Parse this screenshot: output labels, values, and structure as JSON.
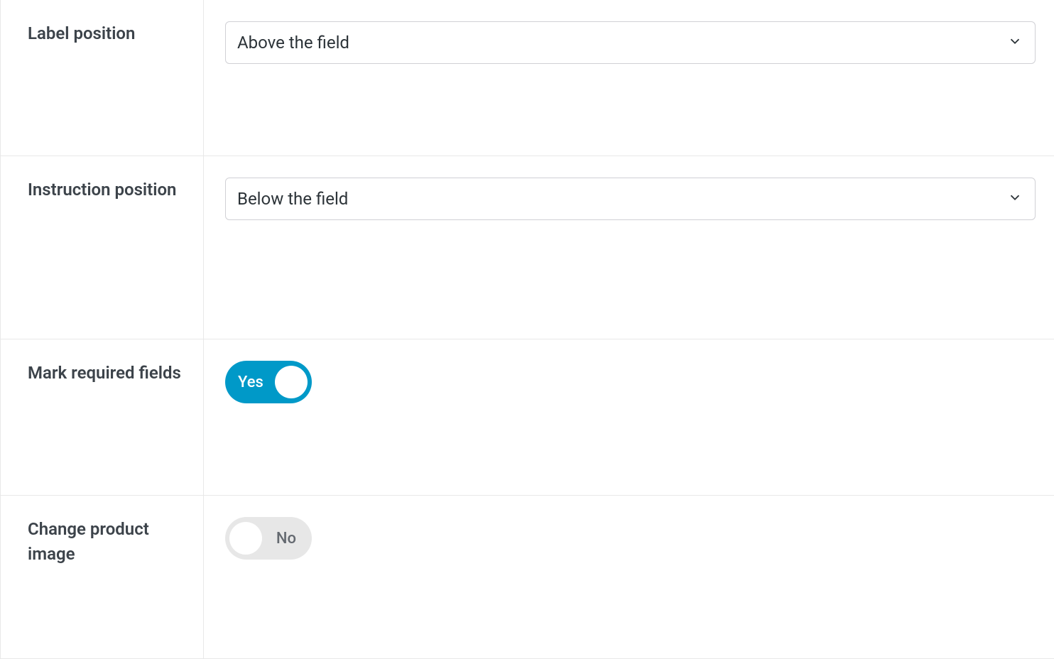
{
  "settings": {
    "label_position": {
      "label": "Label position",
      "value": "Above the field"
    },
    "instruction_position": {
      "label": "Instruction position",
      "value": "Below the field"
    },
    "mark_required_fields": {
      "label": "Mark required fields",
      "state": "on",
      "text": "Yes"
    },
    "change_product_image": {
      "label": "Change product image",
      "state": "off",
      "text": "No"
    }
  }
}
